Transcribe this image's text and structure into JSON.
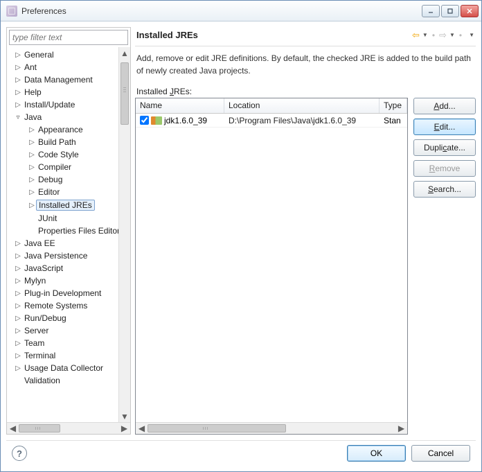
{
  "window": {
    "title": "Preferences"
  },
  "filter": {
    "placeholder": "type filter text"
  },
  "tree": [
    {
      "label": "General",
      "level": 0,
      "expand": "▷"
    },
    {
      "label": "Ant",
      "level": 0,
      "expand": "▷"
    },
    {
      "label": "Data Management",
      "level": 0,
      "expand": "▷"
    },
    {
      "label": "Help",
      "level": 0,
      "expand": "▷"
    },
    {
      "label": "Install/Update",
      "level": 0,
      "expand": "▷"
    },
    {
      "label": "Java",
      "level": 0,
      "expand": "▿"
    },
    {
      "label": "Appearance",
      "level": 1,
      "expand": "▷"
    },
    {
      "label": "Build Path",
      "level": 1,
      "expand": "▷"
    },
    {
      "label": "Code Style",
      "level": 1,
      "expand": "▷"
    },
    {
      "label": "Compiler",
      "level": 1,
      "expand": "▷"
    },
    {
      "label": "Debug",
      "level": 1,
      "expand": "▷"
    },
    {
      "label": "Editor",
      "level": 1,
      "expand": "▷"
    },
    {
      "label": "Installed JREs",
      "level": 1,
      "expand": "▷",
      "selected": true
    },
    {
      "label": "JUnit",
      "level": 1,
      "expand": ""
    },
    {
      "label": "Properties Files Editor",
      "level": 1,
      "expand": ""
    },
    {
      "label": "Java EE",
      "level": 0,
      "expand": "▷"
    },
    {
      "label": "Java Persistence",
      "level": 0,
      "expand": "▷"
    },
    {
      "label": "JavaScript",
      "level": 0,
      "expand": "▷"
    },
    {
      "label": "Mylyn",
      "level": 0,
      "expand": "▷"
    },
    {
      "label": "Plug-in Development",
      "level": 0,
      "expand": "▷"
    },
    {
      "label": "Remote Systems",
      "level": 0,
      "expand": "▷"
    },
    {
      "label": "Run/Debug",
      "level": 0,
      "expand": "▷"
    },
    {
      "label": "Server",
      "level": 0,
      "expand": "▷"
    },
    {
      "label": "Team",
      "level": 0,
      "expand": "▷"
    },
    {
      "label": "Terminal",
      "level": 0,
      "expand": "▷"
    },
    {
      "label": "Usage Data Collector",
      "level": 0,
      "expand": "▷"
    },
    {
      "label": "Validation",
      "level": 0,
      "expand": ""
    }
  ],
  "section": {
    "title": "Installed JREs",
    "description": "Add, remove or edit JRE definitions. By default, the checked JRE is added to the build path of newly created Java projects.",
    "table_label_pre": "Installed ",
    "table_label_u": "J",
    "table_label_post": "REs:",
    "columns": {
      "name": "Name",
      "location": "Location",
      "type": "Type"
    },
    "rows": [
      {
        "checked": true,
        "name": "jdk1.6.0_39",
        "location": "D:\\Program Files\\Java\\jdk1.6.0_39",
        "type": "Stan"
      }
    ]
  },
  "buttons": {
    "add_u": "A",
    "add_post": "dd...",
    "edit_u": "E",
    "edit_post": "dit...",
    "dup_pre": "Dupli",
    "dup_u": "c",
    "dup_post": "ate...",
    "rem_u": "R",
    "rem_post": "emove",
    "search_u": "S",
    "search_post": "earch..."
  },
  "footer": {
    "ok": "OK",
    "cancel": "Cancel"
  }
}
